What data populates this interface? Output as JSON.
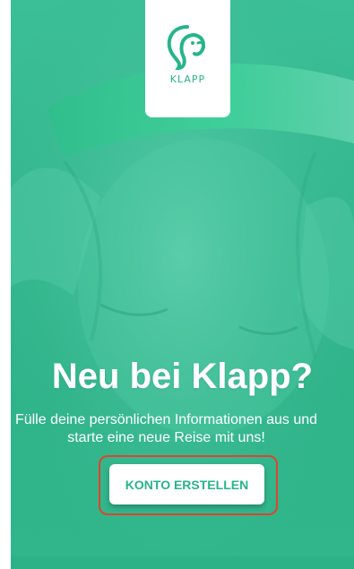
{
  "brand": {
    "name": "KLAPP",
    "color": "#27b48a"
  },
  "hero": {
    "headline": "Neu bei Klapp?",
    "subtext_line1": "Fülle deine persönlichen Informationen aus und",
    "subtext_line2": "starte eine neue Reise mit uns!"
  },
  "cta": {
    "label": "KONTO ERSTELLEN",
    "highlight_color": "#e0432e"
  },
  "colors": {
    "overlay": "#35b88f",
    "text": "#ffffff"
  }
}
